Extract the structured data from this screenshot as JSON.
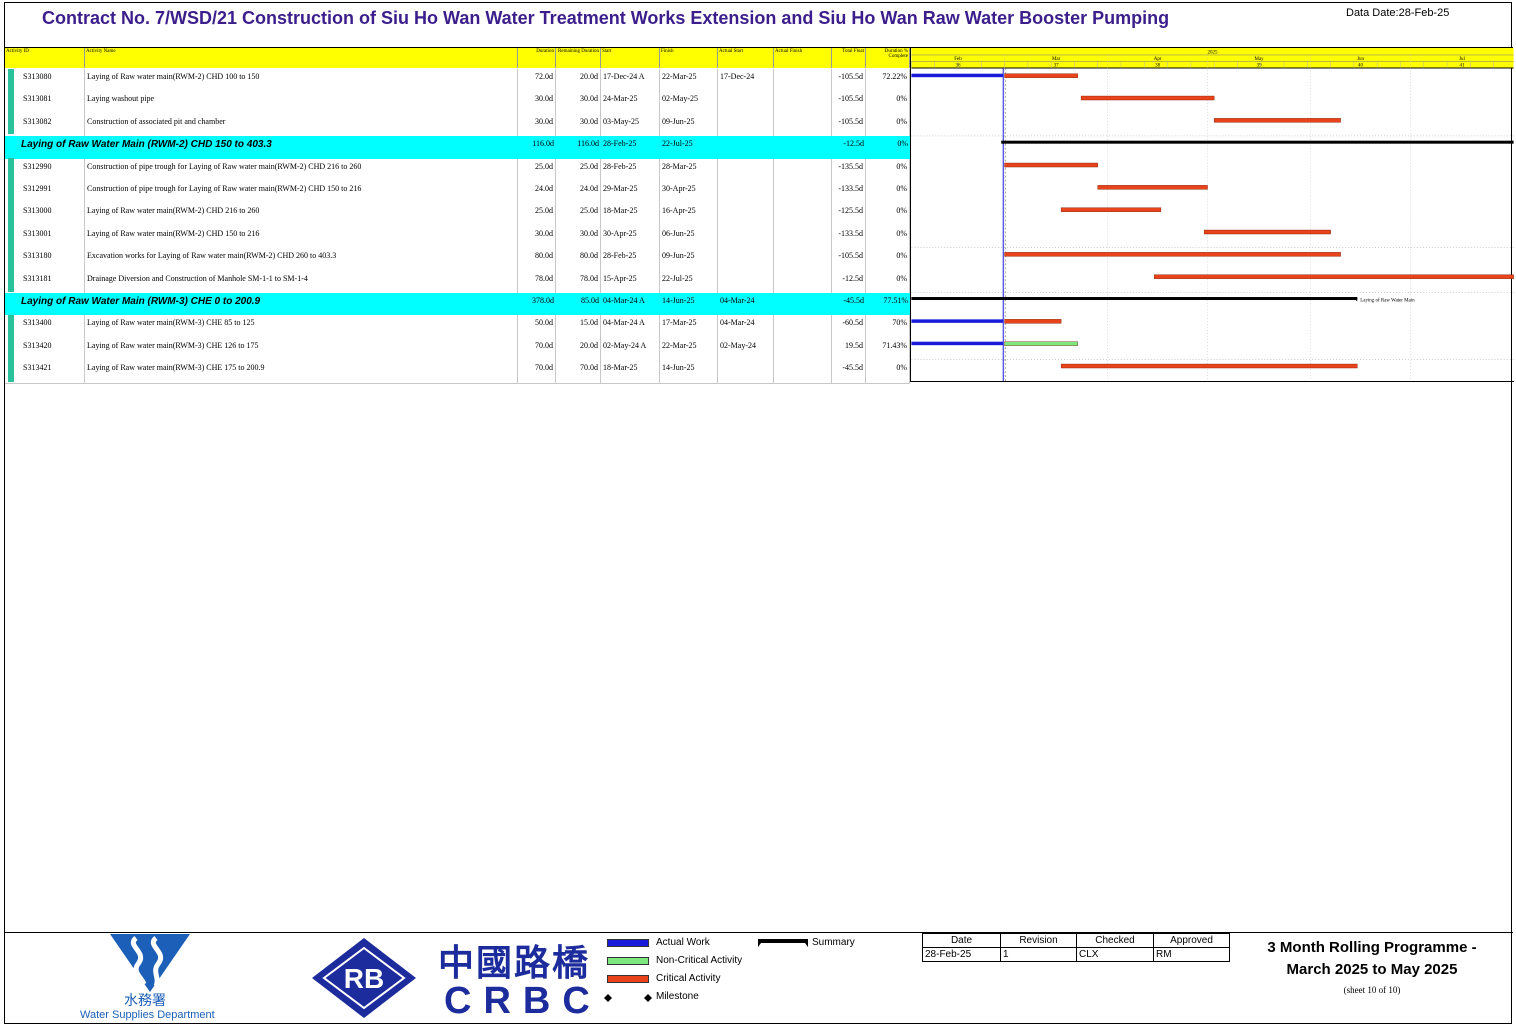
{
  "header": {
    "title": "Contract No. 7/WSD/21 Construction of Siu Ho Wan Water Treatment Works Extension and Siu Ho Wan Raw Water Booster Pumping",
    "data_date": "Data Date:28-Feb-25"
  },
  "columns": {
    "activity_id": "Activity ID",
    "activity_name": "Activity Name",
    "duration": "Duration",
    "remaining_duration": "Remaining Duration",
    "start": "Start",
    "finish": "Finish",
    "actual_start": "Actual Start",
    "actual_finish": "Actual Finish",
    "total_float": "Total Float",
    "duration_pct": "Duration % Complete"
  },
  "timeline": {
    "year": "2025",
    "months": [
      "Feb",
      "Mar",
      "Apr",
      "May",
      "Jun",
      "Jul"
    ],
    "periods": [
      "36",
      "37",
      "38",
      "39",
      "40",
      "41"
    ]
  },
  "chart_data": {
    "type": "gantt",
    "timeline_start": "2025-02-01",
    "timeline_end": "2025-07-31",
    "data_date": "2025-02-28",
    "rows": [
      {
        "kind": "activity",
        "id": "S313080",
        "name": "Laying of Raw water main(RWM-2) CHD 100 to 150",
        "duration": "72.0d",
        "remaining": "20.0d",
        "start": "17-Dec-24 A",
        "finish": "22-Mar-25",
        "actual_start": "17-Dec-24",
        "actual_finish": "",
        "total_float": "-105.5d",
        "pct": "72.22%",
        "bar": "critical",
        "actual_bar": true,
        "bar_start": "2025-03-01",
        "bar_end": "2025-03-22"
      },
      {
        "kind": "activity",
        "id": "S313081",
        "name": "Laying washout pipe",
        "duration": "30.0d",
        "remaining": "30.0d",
        "start": "24-Mar-25",
        "finish": "02-May-25",
        "actual_start": "",
        "actual_finish": "",
        "total_float": "-105.5d",
        "pct": "0%",
        "bar": "critical",
        "actual_bar": false,
        "bar_start": "2025-03-24",
        "bar_end": "2025-05-02"
      },
      {
        "kind": "activity",
        "id": "S313082",
        "name": "Construction of associated pit and chamber",
        "duration": "30.0d",
        "remaining": "30.0d",
        "start": "03-May-25",
        "finish": "09-Jun-25",
        "actual_start": "",
        "actual_finish": "",
        "total_float": "-105.5d",
        "pct": "0%",
        "bar": "critical",
        "actual_bar": false,
        "bar_start": "2025-05-03",
        "bar_end": "2025-06-09"
      },
      {
        "kind": "group",
        "name": "Laying of Raw Water Main (RWM-2) CHD 150  to 403.3",
        "duration": "116.0d",
        "remaining": "116.0d",
        "start": "28-Feb-25",
        "finish": "22-Jul-25",
        "actual_start": "",
        "actual_finish": "",
        "total_float": "-12.5d",
        "pct": "0%",
        "bar": "summary",
        "bar_start": "2025-02-28",
        "bar_end": "2025-07-31"
      },
      {
        "kind": "activity",
        "id": "S312990",
        "name": "Construction of pipe trough for Laying of Raw water main(RWM-2) CHD 216 to 260",
        "duration": "25.0d",
        "remaining": "25.0d",
        "start": "28-Feb-25",
        "finish": "28-Mar-25",
        "actual_start": "",
        "actual_finish": "",
        "total_float": "-135.5d",
        "pct": "0%",
        "bar": "critical",
        "actual_bar": false,
        "bar_start": "2025-03-01",
        "bar_end": "2025-03-28"
      },
      {
        "kind": "activity",
        "id": "S312991",
        "name": "Construction of pipe trough for Laying of Raw water main(RWM-2) CHD 150 to 216",
        "duration": "24.0d",
        "remaining": "24.0d",
        "start": "29-Mar-25",
        "finish": "30-Apr-25",
        "actual_start": "",
        "actual_finish": "",
        "total_float": "-133.5d",
        "pct": "0%",
        "bar": "critical",
        "actual_bar": false,
        "bar_start": "2025-03-29",
        "bar_end": "2025-04-30"
      },
      {
        "kind": "activity",
        "id": "S313000",
        "name": "Laying of Raw water main(RWM-2) CHD 216 to 260",
        "duration": "25.0d",
        "remaining": "25.0d",
        "start": "18-Mar-25",
        "finish": "16-Apr-25",
        "actual_start": "",
        "actual_finish": "",
        "total_float": "-125.5d",
        "pct": "0%",
        "bar": "critical",
        "actual_bar": false,
        "bar_start": "2025-03-18",
        "bar_end": "2025-04-16"
      },
      {
        "kind": "activity",
        "id": "S313001",
        "name": "Laying of Raw water main(RWM-2) CHD 150 to 216",
        "duration": "30.0d",
        "remaining": "30.0d",
        "start": "30-Apr-25",
        "finish": "06-Jun-25",
        "actual_start": "",
        "actual_finish": "",
        "total_float": "-133.5d",
        "pct": "0%",
        "bar": "critical",
        "actual_bar": false,
        "bar_start": "2025-04-30",
        "bar_end": "2025-06-06"
      },
      {
        "kind": "activity",
        "id": "S313180",
        "name": "Excavation works for Laying of Raw water main(RWM-2) CHD 260 to 403.3",
        "duration": "80.0d",
        "remaining": "80.0d",
        "start": "28-Feb-25",
        "finish": "09-Jun-25",
        "actual_start": "",
        "actual_finish": "",
        "total_float": "-105.5d",
        "pct": "0%",
        "bar": "critical",
        "actual_bar": false,
        "bar_start": "2025-03-01",
        "bar_end": "2025-06-09"
      },
      {
        "kind": "activity",
        "id": "S313181",
        "name": "Drainage Diversion and Construction of Manhole SM-1-1 to SM-1-4",
        "duration": "78.0d",
        "remaining": "78.0d",
        "start": "15-Apr-25",
        "finish": "22-Jul-25",
        "actual_start": "",
        "actual_finish": "",
        "total_float": "-12.5d",
        "pct": "0%",
        "bar": "critical",
        "actual_bar": false,
        "bar_start": "2025-04-15",
        "bar_end": "2025-07-31"
      },
      {
        "kind": "group",
        "name": "Laying of Raw Water Main (RWM-3) CHE 0  to 200.9",
        "duration": "378.0d",
        "remaining": "85.0d",
        "start": "04-Mar-24 A",
        "finish": "14-Jun-25",
        "actual_start": "04-Mar-24",
        "actual_finish": "",
        "total_float": "-45.5d",
        "pct": "77.51%",
        "bar": "summary",
        "bar_start": "2025-02-01",
        "bar_end": "2025-06-14",
        "bar_label": "Laying of Raw Water Main"
      },
      {
        "kind": "activity",
        "id": "S313400",
        "name": "Laying of Raw water main(RWM-3) CHE 85 to 125",
        "duration": "50.0d",
        "remaining": "15.0d",
        "start": "04-Mar-24 A",
        "finish": "17-Mar-25",
        "actual_start": "04-Mar-24",
        "actual_finish": "",
        "total_float": "-60.5d",
        "pct": "70%",
        "bar": "critical",
        "actual_bar": true,
        "bar_start": "2025-03-01",
        "bar_end": "2025-03-17"
      },
      {
        "kind": "activity",
        "id": "S313420",
        "name": "Laying of Raw water main(RWM-3) CHE 126 to 175",
        "duration": "70.0d",
        "remaining": "20.0d",
        "start": "02-May-24 A",
        "finish": "22-Mar-25",
        "actual_start": "02-May-24",
        "actual_finish": "",
        "total_float": "19.5d",
        "pct": "71.43%",
        "bar": "noncritical",
        "actual_bar": true,
        "bar_start": "2025-03-01",
        "bar_end": "2025-03-22"
      },
      {
        "kind": "activity",
        "id": "S313421",
        "name": "Laying of Raw water main(RWM-3) CHE 175 to 200.9",
        "duration": "70.0d",
        "remaining": "70.0d",
        "start": "18-Mar-25",
        "finish": "14-Jun-25",
        "actual_start": "",
        "actual_finish": "",
        "total_float": "-45.5d",
        "pct": "0%",
        "bar": "critical",
        "actual_bar": false,
        "bar_start": "2025-03-18",
        "bar_end": "2025-06-14"
      }
    ]
  },
  "legend": {
    "actual_work": "Actual Work",
    "non_critical": "Non-Critical Activity",
    "critical": "Critical Activity",
    "milestone": "Milestone",
    "summary": "Summary"
  },
  "colors": {
    "actual": "#1a1adb",
    "critical": "#e8431a",
    "noncritical": "#7de87d",
    "group_band": "#00ffff",
    "header": "#ffff00"
  },
  "revision": {
    "headers": [
      "Date",
      "Revision",
      "Checked",
      "Approved"
    ],
    "values": [
      "28-Feb-25",
      "1",
      "CLX",
      "RM"
    ]
  },
  "programme": {
    "title_line1": "3 Month Rolling Programme -",
    "title_line2": "March 2025 to May 2025",
    "sheet": "(sheet 10 of 10)"
  },
  "logos": {
    "wsd_cn": "水務署",
    "wsd_en": "Water Supplies Department",
    "crbc_cn": "中國路橋",
    "crbc_en": "CRBC",
    "rb": "RB"
  }
}
